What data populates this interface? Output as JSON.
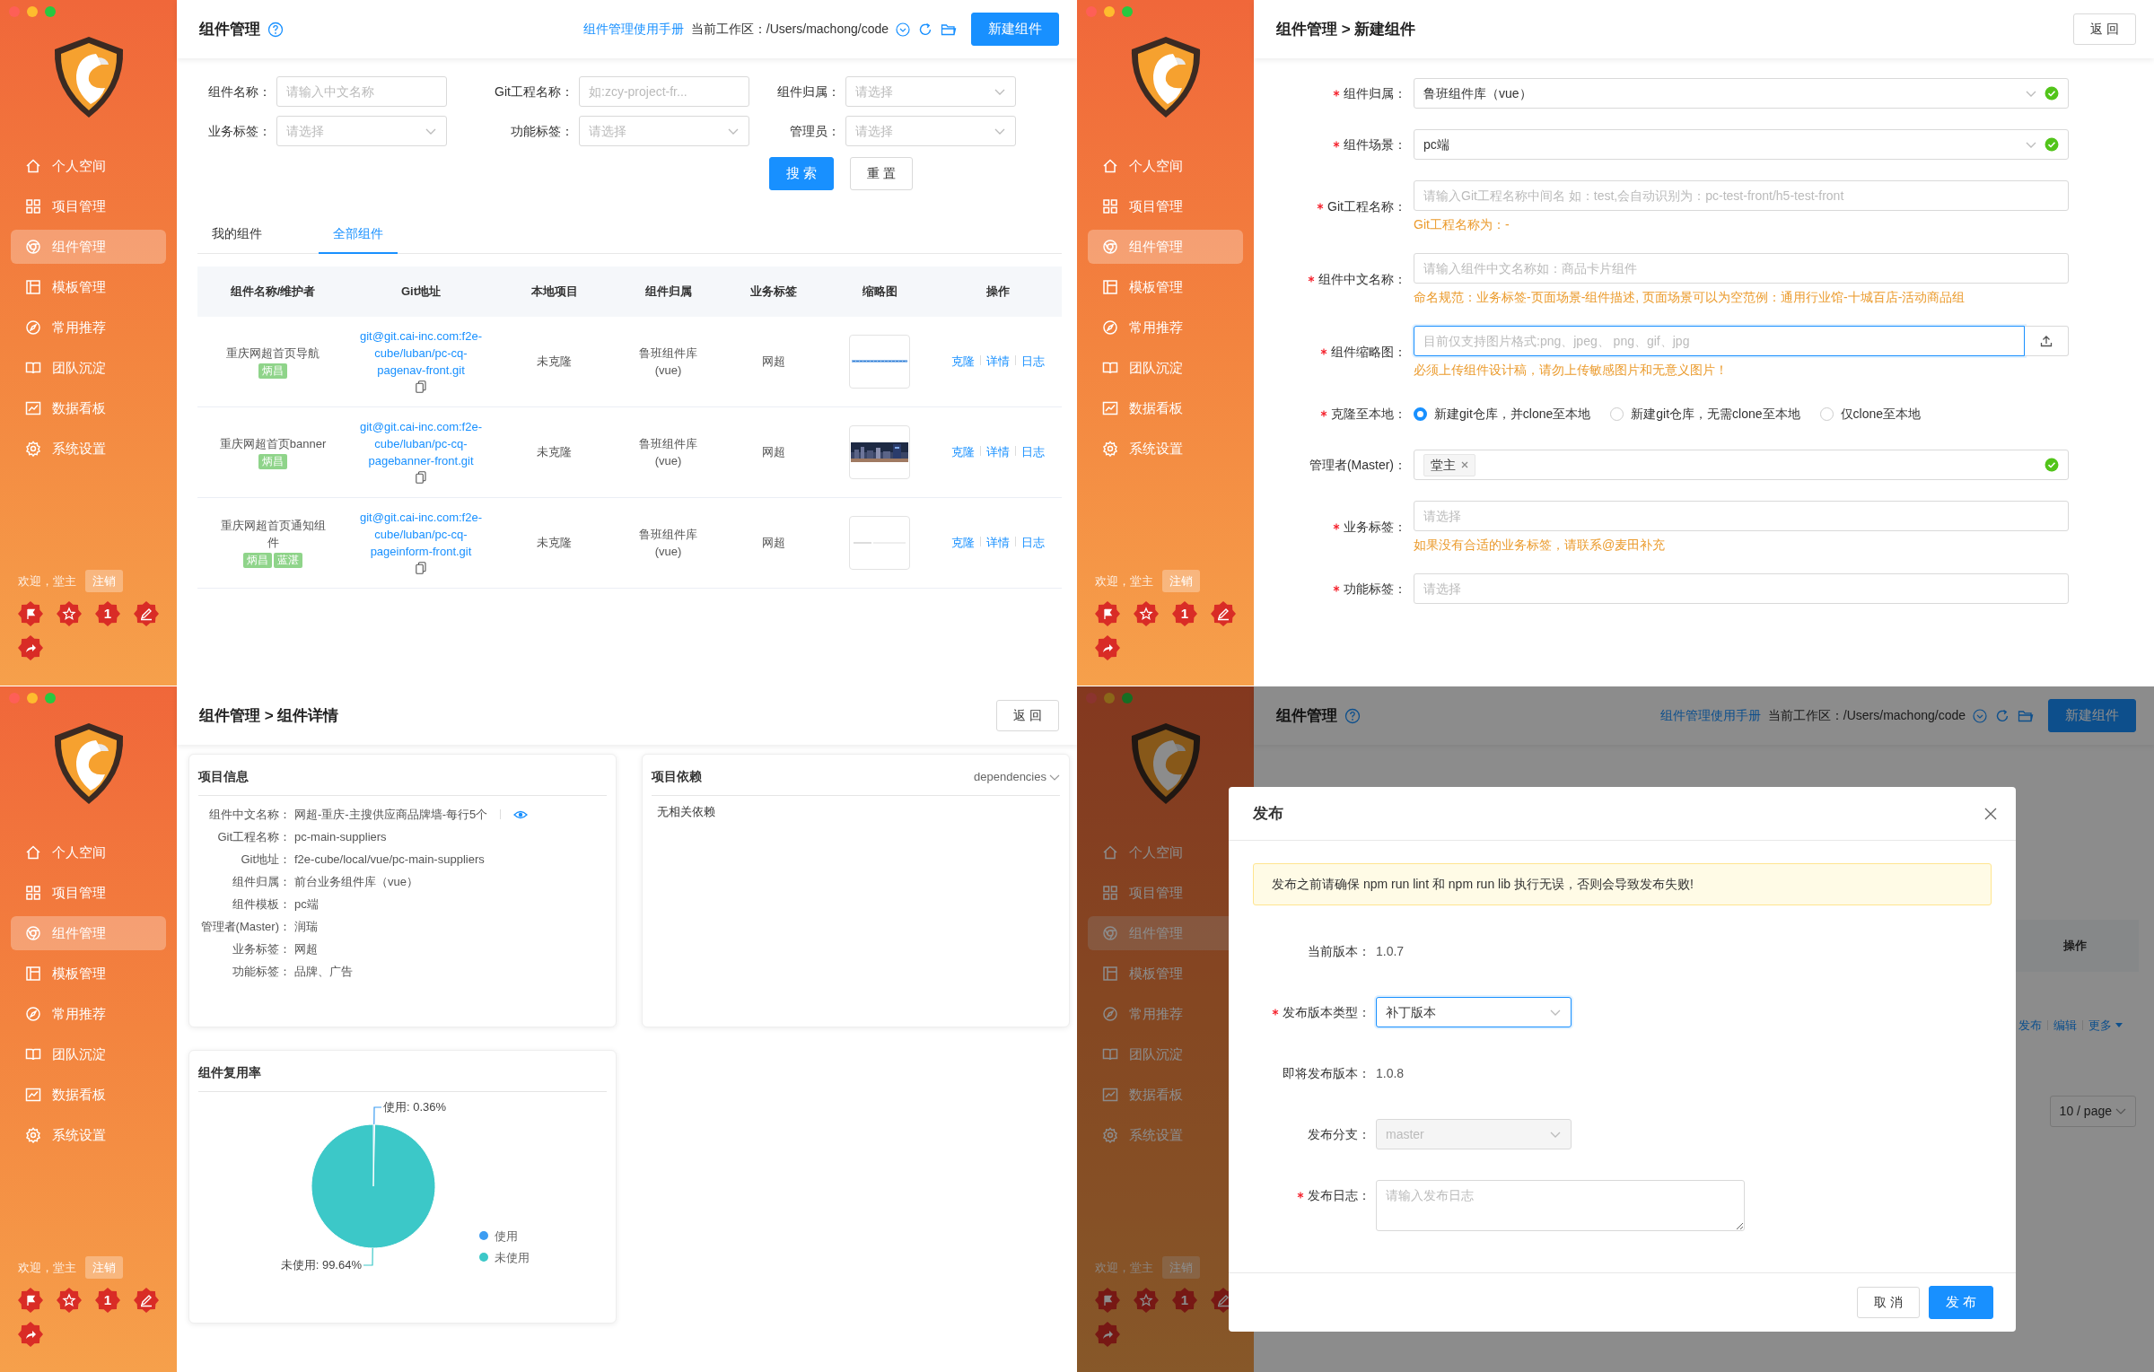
{
  "panels": [
    {
      "kind": "list",
      "sidebar": {
        "items": [
          {
            "label": "个人空间",
            "selected": false
          },
          {
            "label": "项目管理",
            "selected": false
          },
          {
            "label": "组件管理",
            "selected": true
          },
          {
            "label": "模板管理",
            "selected": false
          },
          {
            "label": "常用推荐",
            "selected": false
          },
          {
            "label": "团队沉淀",
            "selected": false
          },
          {
            "label": "数据看板",
            "selected": false
          },
          {
            "label": "系统设置",
            "selected": false
          }
        ],
        "welcome": "欢迎，堂主",
        "logout": "注销",
        "badges": [
          {
            "kind": "flag"
          },
          {
            "kind": "star"
          },
          {
            "kind": "number",
            "text": "1"
          },
          {
            "kind": "pen"
          },
          {
            "kind": "share"
          }
        ]
      },
      "header": {
        "title": "组件管理",
        "manual_link": "组件管理使用手册",
        "workspace": "当前工作区：/Users/machong/code",
        "new_button": "新建组件"
      },
      "filters": [
        {
          "label": "组件名称：",
          "kind": "input",
          "placeholder": "请输入中文名称"
        },
        {
          "label": "Git工程名称：",
          "kind": "input",
          "placeholder": "如:zcy-project-fr..."
        },
        {
          "label": "组件归属：",
          "kind": "select",
          "placeholder": "请选择"
        },
        {
          "label": "业务标签：",
          "kind": "select",
          "placeholder": "请选择"
        },
        {
          "label": "功能标签：",
          "kind": "select",
          "placeholder": "请选择"
        },
        {
          "label": "管理员：",
          "kind": "select",
          "placeholder": "请选择"
        }
      ],
      "search_button": "搜 索",
      "reset_button": "重 置",
      "tabs": [
        {
          "label": "我的组件",
          "selected": false
        },
        {
          "label": "全部组件",
          "selected": true
        }
      ],
      "table": {
        "columns": [
          "组件名称/维护者",
          "Git地址",
          "本地项目",
          "组件归属",
          "业务标签",
          "缩略图",
          "操作"
        ],
        "rows": [
          {
            "name": "重庆网超首页导航",
            "maintainers": [
              "炳昌"
            ],
            "git": "git@git.cai-inc.com:f2e-cube/luban/pc-cq-pagenav-front.git",
            "local": "未克隆",
            "owner": "鲁班组件库(vue)",
            "business_tag": "网超",
            "thumbnail": {
              "kind": "nav"
            },
            "actions": [
              "克隆",
              "详情",
              "日志"
            ]
          },
          {
            "name": "重庆网超首页banner",
            "maintainers": [
              "炳昌"
            ],
            "git": "git@git.cai-inc.com:f2e-cube/luban/pc-cq-pagebanner-front.git",
            "local": "未克隆",
            "owner": "鲁班组件库(vue)",
            "business_tag": "网超",
            "thumbnail": {
              "kind": "banner"
            },
            "actions": [
              "克隆",
              "详情",
              "日志"
            ]
          },
          {
            "name": "重庆网超首页通知组件",
            "maintainers": [
              "炳昌",
              "蓝湛"
            ],
            "git": "git@git.cai-inc.com:f2e-cube/luban/pc-cq-pageinform-front.git",
            "local": "未克隆",
            "owner": "鲁班组件库(vue)",
            "business_tag": "网超",
            "thumbnail": {
              "kind": "inform"
            },
            "actions": [
              "克隆",
              "详情",
              "日志"
            ]
          }
        ]
      }
    },
    {
      "kind": "create",
      "sidebar": {
        "items": [
          {
            "label": "个人空间",
            "selected": false
          },
          {
            "label": "项目管理",
            "selected": false
          },
          {
            "label": "组件管理",
            "selected": true
          },
          {
            "label": "模板管理",
            "selected": false
          },
          {
            "label": "常用推荐",
            "selected": false
          },
          {
            "label": "团队沉淀",
            "selected": false
          },
          {
            "label": "数据看板",
            "selected": false
          },
          {
            "label": "系统设置",
            "selected": false
          }
        ],
        "welcome": "欢迎，堂主",
        "logout": "注销",
        "badges": [
          {
            "kind": "flag"
          },
          {
            "kind": "star"
          },
          {
            "kind": "number",
            "text": "1"
          },
          {
            "kind": "pen"
          },
          {
            "kind": "share"
          }
        ]
      },
      "header": {
        "title": "组件管理 > 新建组件",
        "back_button": "返 回"
      },
      "fields": [
        {
          "kind": "select",
          "label": "组件归属：",
          "required": true,
          "value": "鲁班组件库（vue）",
          "valid": true,
          "focused": false
        },
        {
          "kind": "select",
          "label": "组件场景：",
          "required": true,
          "value": "pc端",
          "valid": true,
          "focused": false
        },
        {
          "kind": "input",
          "label": "Git工程名称：",
          "required": true,
          "placeholder": "请输入Git工程名称中间名 如：test,会自动识别为：pc-test-front/h5-test-front",
          "help": "Git工程名称为：-",
          "valid": false,
          "focused": false
        },
        {
          "kind": "input",
          "label": "组件中文名称：",
          "required": true,
          "placeholder": "请输入组件中文名称如：商品卡片组件",
          "help": "命名规范：业务标签-页面场景-组件描述, 页面场景可以为空范例：通用行业馆-十城百店-活动商品组",
          "valid": false,
          "focused": false
        },
        {
          "kind": "upload",
          "label": "组件缩略图：",
          "required": true,
          "placeholder": "目前仅支持图片格式:png、jpeg、 png、gif、jpg",
          "help": "必须上传组件设计稿，请勿上传敏感图片和无意义图片！",
          "valid": false,
          "focused": true
        },
        {
          "kind": "radio",
          "label": "克隆至本地：",
          "required": true,
          "options": [
            {
              "label": "新建git仓库，并clone至本地",
              "selected": true
            },
            {
              "label": "新建git仓库，无需clone至本地",
              "selected": false
            },
            {
              "label": "仅clone至本地",
              "selected": false
            }
          ]
        },
        {
          "kind": "tags",
          "label": "管理者(Master)：",
          "required": false,
          "tags": [
            "堂主"
          ],
          "valid": true,
          "focused": false
        },
        {
          "kind": "input",
          "label": "业务标签：",
          "required": true,
          "placeholder": "请选择",
          "help": "如果没有合适的业务标签，请联系@麦田补充",
          "valid": false,
          "focused": false
        },
        {
          "kind": "input",
          "label": "功能标签：",
          "required": true,
          "placeholder": "请选择",
          "valid": false,
          "focused": false
        }
      ]
    },
    {
      "kind": "detail",
      "sidebar": {
        "items": [
          {
            "label": "个人空间",
            "selected": false
          },
          {
            "label": "项目管理",
            "selected": false
          },
          {
            "label": "组件管理",
            "selected": true
          },
          {
            "label": "模板管理",
            "selected": false
          },
          {
            "label": "常用推荐",
            "selected": false
          },
          {
            "label": "团队沉淀",
            "selected": false
          },
          {
            "label": "数据看板",
            "selected": false
          },
          {
            "label": "系统设置",
            "selected": false
          }
        ],
        "welcome": "欢迎，堂主",
        "logout": "注销",
        "badges": [
          {
            "kind": "flag"
          },
          {
            "kind": "star"
          },
          {
            "kind": "number",
            "text": "1"
          },
          {
            "kind": "pen"
          },
          {
            "kind": "share"
          }
        ]
      },
      "header": {
        "title": "组件管理 > 组件详情",
        "back_button": "返 回"
      },
      "info_card": {
        "title": "项目信息",
        "rows": [
          {
            "label": "组件中文名称：",
            "value": "网超-重庆-主搜供应商品牌墙-每行5个",
            "preview": true
          },
          {
            "label": "Git工程名称：",
            "value": "pc-main-suppliers",
            "preview": false
          },
          {
            "label": "Git地址：",
            "value": "f2e-cube/local/vue/pc-main-suppliers",
            "preview": false
          },
          {
            "label": "组件归属：",
            "value": "前台业务组件库（vue）",
            "preview": false
          },
          {
            "label": "组件模板：",
            "value": "pc端",
            "preview": false
          },
          {
            "label": "管理者(Master)：",
            "value": "润瑞",
            "preview": false
          },
          {
            "label": "业务标签：",
            "value": "网超",
            "preview": false
          },
          {
            "label": "功能标签：",
            "value": "品牌、广告",
            "preview": false
          }
        ]
      },
      "deps_card": {
        "title": "项目依赖",
        "dropdown": "dependencies",
        "empty_text": "无相关依赖"
      },
      "reuse_card": {
        "title": "组件复用率",
        "chart_data": {
          "type": "pie",
          "categories": [
            "使用",
            "未使用"
          ],
          "values": [
            0.36,
            99.64
          ],
          "colors": [
            "#3d9df2",
            "#3cc8c8"
          ],
          "value_labels": [
            "使用: 0.36%",
            "未使用: 99.64%"
          ],
          "legend": "right"
        }
      }
    },
    {
      "kind": "publish",
      "sidebar": {
        "items": [
          {
            "label": "个人空间",
            "selected": false
          },
          {
            "label": "项目管理",
            "selected": false
          },
          {
            "label": "组件管理",
            "selected": true
          },
          {
            "label": "模板管理",
            "selected": false
          },
          {
            "label": "常用推荐",
            "selected": false
          },
          {
            "label": "团队沉淀",
            "selected": false
          },
          {
            "label": "数据看板",
            "selected": false
          },
          {
            "label": "系统设置",
            "selected": false
          }
        ],
        "welcome": "欢迎，堂主",
        "logout": "注销",
        "badges": [
          {
            "kind": "flag"
          },
          {
            "kind": "star"
          },
          {
            "kind": "number",
            "text": "1"
          },
          {
            "kind": "pen"
          },
          {
            "kind": "share"
          }
        ]
      },
      "header": {
        "title": "组件管理",
        "manual_link": "组件管理使用手册",
        "workspace": "当前工作区：/Users/machong/code",
        "new_button": "新建组件"
      },
      "table_header": "操作",
      "row_actions": [
        {
          "label": "发布",
          "menu": false
        },
        {
          "label": "编辑",
          "menu": false
        },
        {
          "label": "更多",
          "menu": true
        }
      ],
      "page_size": "10 / page",
      "modal": {
        "title": "发布",
        "alert": "发布之前请确保 npm run lint 和 npm run lib 执行无误，否则会导致发布失败!",
        "fields": [
          {
            "kind": "text",
            "label": "当前版本：",
            "required": false,
            "value": "1.0.7"
          },
          {
            "kind": "select",
            "label": "发布版本类型：",
            "required": true,
            "value": "补丁版本",
            "focused": true,
            "disabled": false
          },
          {
            "kind": "text",
            "label": "即将发布版本：",
            "required": false,
            "value": "1.0.8"
          },
          {
            "kind": "select",
            "label": "发布分支：",
            "required": false,
            "value": "master",
            "focused": false,
            "disabled": true
          },
          {
            "kind": "textarea",
            "label": "发布日志：",
            "required": true,
            "placeholder": "请输入发布日志"
          }
        ],
        "cancel_button": "取 消",
        "submit_button": "发 布"
      }
    }
  ]
}
